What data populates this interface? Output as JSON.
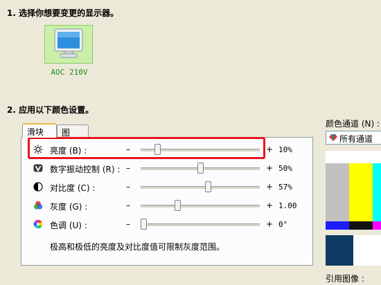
{
  "step1": {
    "title": "1. 选择你想要变更的显示器。"
  },
  "monitor": {
    "name": "AOC 210V"
  },
  "step2": {
    "title": "2. 应用以下颜色设置。"
  },
  "tabs": [
    {
      "label": "滑块"
    },
    {
      "label": "图"
    }
  ],
  "sliders": [
    {
      "label": "亮度 (B) :",
      "value_text": "10%",
      "level": 0.12,
      "minus": "–",
      "plus": "+"
    },
    {
      "label": "数字振动控制 (R) :",
      "value_text": "50%",
      "level": 0.5,
      "minus": "–",
      "plus": "+"
    },
    {
      "label": "对比度 (C) :",
      "value_text": "57%",
      "level": 0.57,
      "minus": "–",
      "plus": "+"
    },
    {
      "label": "灰度 (G) :",
      "value_text": "1.00",
      "level": 0.3,
      "minus": "–",
      "plus": "+"
    },
    {
      "label": "色调 (U) :",
      "value_text": "0°",
      "level": 0.0,
      "minus": "–",
      "plus": "+"
    }
  ],
  "icons": [
    "brightness-sun-icon",
    "digital-vibrance-icon",
    "contrast-icon",
    "gamma-icon",
    "hue-icon"
  ],
  "note": "极高和极低的亮度及对比度值可限制灰度范围。",
  "channel": {
    "label": "颜色通道 (N) :",
    "value": "所有通道"
  },
  "reference": {
    "label": "引用图像 :"
  },
  "colors": {
    "highlight": "#e8161d",
    "accent_tab": "#f0b447",
    "monitor_label": "#1a8f1a"
  }
}
